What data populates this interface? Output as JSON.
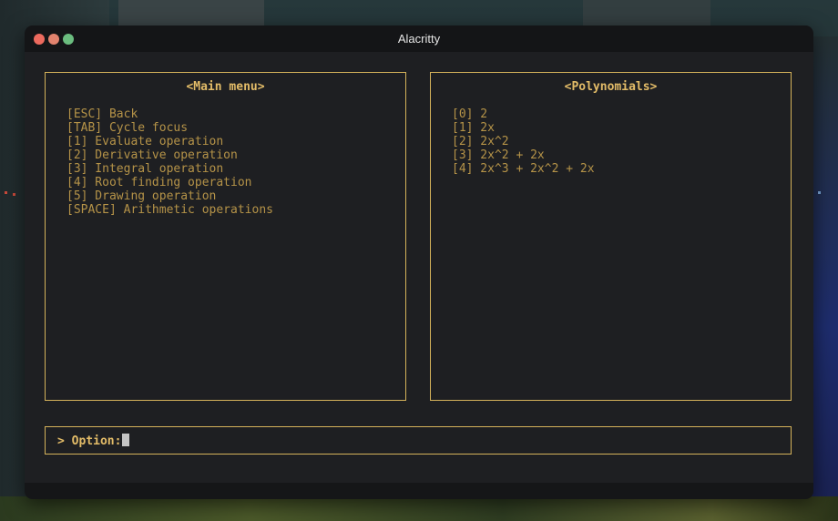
{
  "window": {
    "title": "Alacritty"
  },
  "main_menu": {
    "title": "<Main menu>",
    "items": [
      "[ESC] Back",
      "[TAB] Cycle focus",
      "[1] Evaluate operation",
      "[2] Derivative operation",
      "[3] Integral operation",
      "[4] Root finding operation",
      "[5] Drawing operation",
      "[SPACE] Arithmetic operations"
    ]
  },
  "polynomials": {
    "title": "<Polynomials>",
    "items": [
      "[0] 2",
      "[1] 2x",
      "[2] 2x^2",
      "[3] 2x^2 + 2x",
      "[4] 2x^3 + 2x^2 + 2x"
    ]
  },
  "input": {
    "prompt": "> Option:",
    "value": ""
  },
  "colors": {
    "border": "#d5b25a",
    "text": "#b59348",
    "accent": "#e3bc68",
    "background": "#1e1f22"
  }
}
